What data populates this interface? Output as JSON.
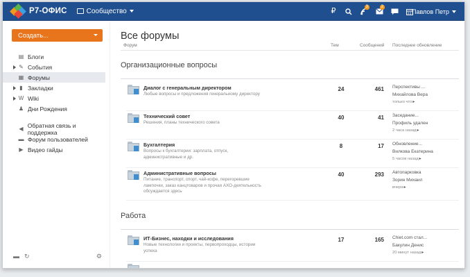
{
  "header": {
    "logo_text": "Р7-ОФИС",
    "module_label": "Сообщество",
    "user_name": "Павлов Петр",
    "icons": [
      "currency-icon",
      "search-icon",
      "feed-icon",
      "mail-icon",
      "chat-icon",
      "calendar-icon"
    ],
    "badges": {
      "feed": "3",
      "mail": "2"
    }
  },
  "sidebar": {
    "create_label": "Создать...",
    "items": [
      {
        "label": "Блоги",
        "icon": "blog-icon",
        "arrow": false,
        "selected": false
      },
      {
        "label": "События",
        "icon": "event-icon",
        "arrow": true,
        "selected": false
      },
      {
        "label": "Форумы",
        "icon": "forum-icon",
        "arrow": false,
        "selected": true
      },
      {
        "label": "Закладки",
        "icon": "bookmark-icon",
        "arrow": true,
        "selected": false
      },
      {
        "label": "Wiki",
        "icon": "wiki-icon",
        "arrow": true,
        "selected": false
      },
      {
        "label": "Дни Рождения",
        "icon": "birthday-icon",
        "arrow": false,
        "selected": false
      }
    ],
    "items2": [
      {
        "label": "Обратная связь и поддержка",
        "icon": "feedback-icon"
      },
      {
        "label": "Форум пользователей",
        "icon": "user-forum-icon"
      },
      {
        "label": "Видео гайды",
        "icon": "video-icon"
      }
    ]
  },
  "main": {
    "title": "Все форумы",
    "columns": {
      "forum": "Форум",
      "topics": "Тем",
      "messages": "Сообщений",
      "last": "Последнее обновление"
    },
    "sections": [
      {
        "title": "Организационные вопросы",
        "forums": [
          {
            "title": "Диалог с генеральным директором",
            "desc": "Любые вопросы и предложения генеральному директору",
            "topics": "24",
            "messages": "461",
            "last_title": "Перспективы ...",
            "last_user": "Михайлова Вера",
            "last_time": "только что"
          },
          {
            "title": "Технический совет",
            "desc": "Решения, планы технического совета",
            "topics": "40",
            "messages": "41",
            "last_title": "Заседание...",
            "last_user": "Профиль удален",
            "last_time": "2 часа назад"
          },
          {
            "title": "Бухгалтерия",
            "desc": "Вопросы к бухгалтерии: зарплата, отпуск, административные и др.",
            "topics": "8",
            "messages": "17",
            "last_title": "Обновление...",
            "last_user": "Вилкова Екатерина",
            "last_time": "5 часов назад"
          },
          {
            "title": "Административные вопросы",
            "desc": "Питание, транспорт, спорт, чай-кофе, перегоревшие лампочки, заказ канцтоваров и прочая АХО-деятельность обсуждается здесь",
            "topics": "40",
            "messages": "293",
            "last_title": "Автопарковка",
            "last_user": "Зорин Михаил",
            "last_time": "вчера"
          }
        ]
      },
      {
        "title": "Работа",
        "forums": [
          {
            "title": "ИТ-Бизнес, находки и исследования",
            "desc": "Новые технологии и проекты, первопроходцы, истории успеха",
            "topics": "17",
            "messages": "165",
            "last_title": "Chiet.com стал...",
            "last_user": "Бакулин Денис",
            "last_time": "20 минут назад"
          }
        ]
      }
    ]
  }
}
